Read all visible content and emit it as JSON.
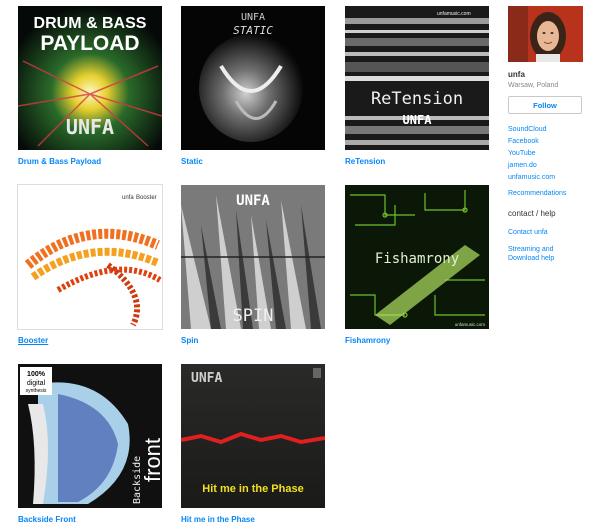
{
  "albums": [
    {
      "title": "Drum & Bass Payload",
      "cover_text": [
        "DRUM & BASS",
        "PAYLOAD"
      ],
      "logo": "UNFA"
    },
    {
      "title": "Static",
      "cover_text": [
        "UNFA",
        "STATIC"
      ]
    },
    {
      "title": "ReTension",
      "cover_text": [
        "unfamusic.com",
        "ReTension",
        "UNFA"
      ]
    },
    {
      "title": "Booster",
      "cover_text": [
        "unfa",
        "Booster"
      ]
    },
    {
      "title": "Spin",
      "cover_text": [
        "UNFA",
        "SPIN"
      ]
    },
    {
      "title": "Fishamrony",
      "cover_text": [
        "Fishamrony",
        "unfamusic.com"
      ]
    },
    {
      "title": "Backside Front",
      "cover_text": [
        "100%",
        "digital",
        "synthesis",
        "Backside",
        "front"
      ]
    },
    {
      "title": "Hit me in the Phase",
      "cover_text": [
        "UNFA",
        "Hit me in the Phase"
      ]
    }
  ],
  "sidebar": {
    "artist": "unfa",
    "location": "Warsaw, Poland",
    "follow_label": "Follow",
    "links": [
      "SoundCloud",
      "Facebook",
      "YouTube",
      "jamen.do",
      "unfamusic.com"
    ],
    "recommendations": "Recommendations",
    "contact_heading": "contact / help",
    "contact_link": "Contact unfa",
    "streaming_link": "Streaming and Download help"
  }
}
